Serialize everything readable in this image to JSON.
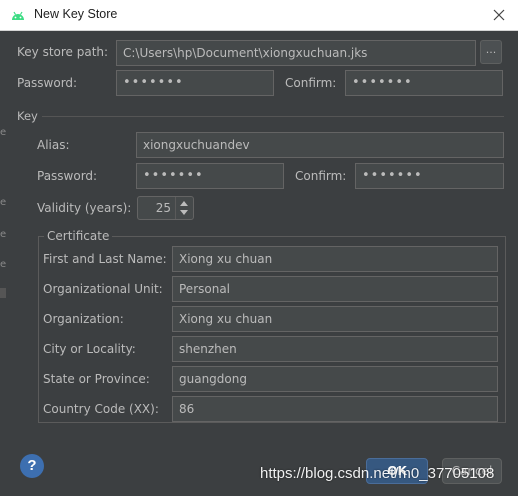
{
  "window": {
    "title": "New Key Store"
  },
  "keystore": {
    "path_label": "Key store path:",
    "path_value": "C:\\Users\\hp\\Document\\xiongxuchuan.jks",
    "browse_label": "...",
    "password_label": "Password:",
    "password_value": "•••••••",
    "confirm_label": "Confirm:",
    "confirm_value": "•••••••"
  },
  "key": {
    "section_label": "Key",
    "alias_label": "Alias:",
    "alias_value": "xiongxuchuandev",
    "password_label": "Password:",
    "password_value": "•••••••",
    "confirm_label": "Confirm:",
    "confirm_value": "•••••••",
    "validity_label": "Validity (years):",
    "validity_value": "25"
  },
  "certificate": {
    "section_label": "Certificate",
    "fields": [
      {
        "label": "First and Last Name:",
        "value": "Xiong xu chuan"
      },
      {
        "label": "Organizational Unit:",
        "value": "Personal"
      },
      {
        "label": "Organization:",
        "value": "Xiong xu chuan"
      },
      {
        "label": "City or Locality:",
        "value": "shenzhen"
      },
      {
        "label": "State or Province:",
        "value": "guangdong"
      },
      {
        "label": "Country Code (XX):",
        "value": "86"
      }
    ]
  },
  "buttons": {
    "ok": "OK",
    "cancel": "Cancel",
    "help": "?"
  },
  "watermark": "https://blog.csdn.net/m0_37705108",
  "colors": {
    "background": "#3c3f41",
    "field": "#45494a",
    "ok_button": "#365880",
    "help": "#3d6fb0"
  }
}
